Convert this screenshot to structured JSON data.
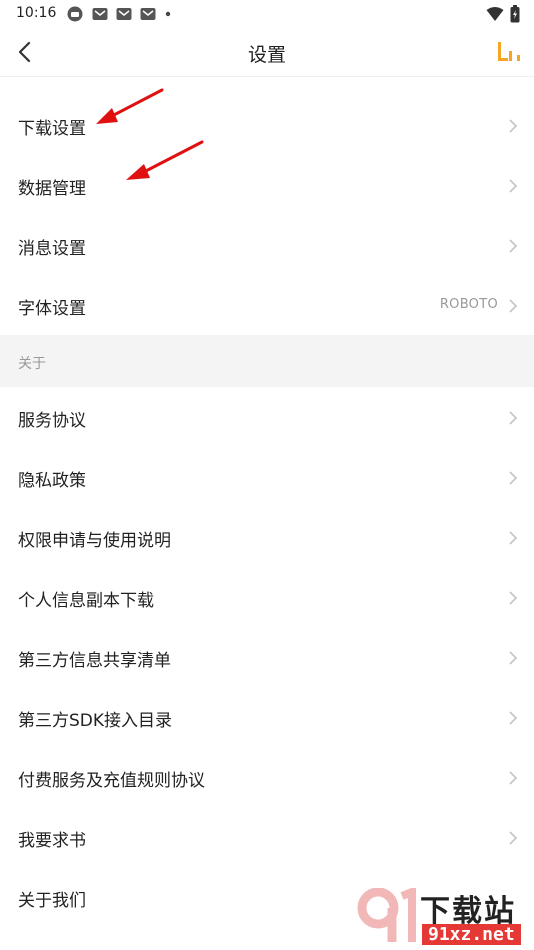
{
  "status_bar": {
    "time": "10:16"
  },
  "header": {
    "title": "设置"
  },
  "settings": [
    {
      "label": "下载设置"
    },
    {
      "label": "数据管理"
    },
    {
      "label": "消息设置"
    },
    {
      "label": "字体设置",
      "value": "ROBOTO"
    }
  ],
  "about": {
    "title": "关于",
    "items": [
      {
        "label": "服务协议"
      },
      {
        "label": "隐私政策"
      },
      {
        "label": "权限申请与使用说明"
      },
      {
        "label": "个人信息副本下载"
      },
      {
        "label": "第三方信息共享清单"
      },
      {
        "label": "第三方SDK接入目录"
      },
      {
        "label": "付费服务及充值规则协议"
      },
      {
        "label": "我要求书"
      },
      {
        "label": "关于我们"
      }
    ]
  },
  "watermark": {
    "main": "下载站",
    "sub": "91xz.net"
  },
  "colors": {
    "accent": "#f5a623",
    "arrow": "#e01010",
    "chevron": "#c4c4c4"
  }
}
